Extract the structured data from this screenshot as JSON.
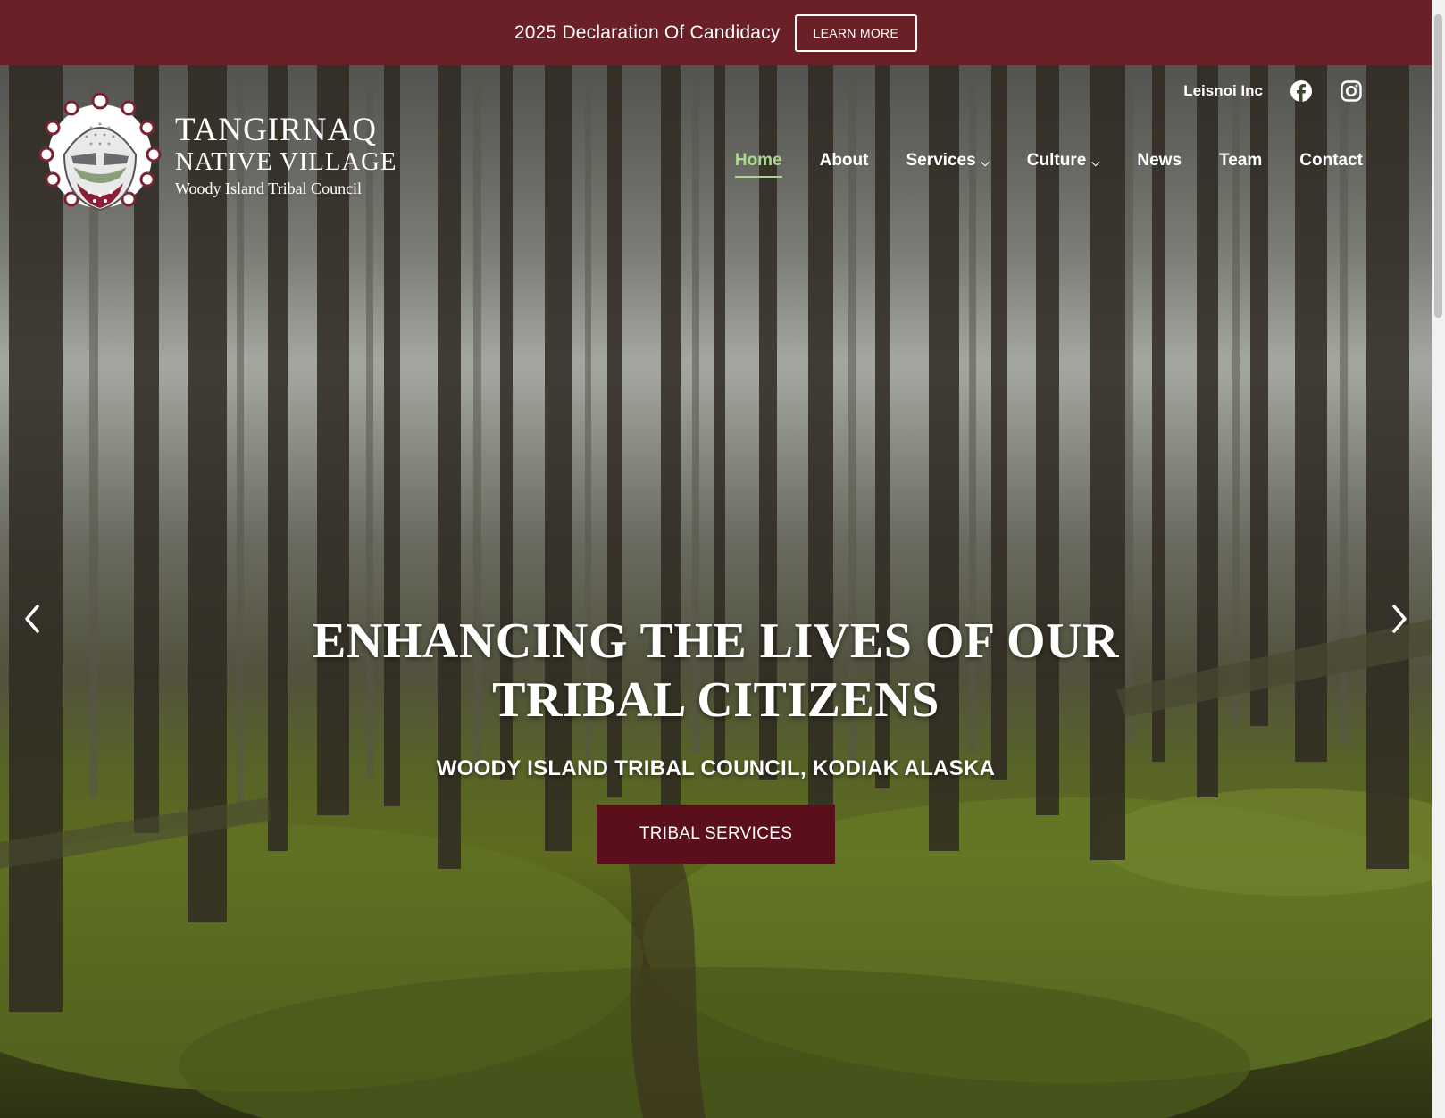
{
  "announcement": {
    "text": "2025 Declaration Of Candidacy",
    "button_label": "LEARN MORE",
    "background_color": "#6b2027"
  },
  "logo": {
    "line1": "TANGIRNAQ",
    "line2": "NATIVE VILLAGE",
    "line3": "Woody Island Tribal Council"
  },
  "utility": {
    "link_label": "Leisnoi Inc",
    "icons": [
      "facebook-icon",
      "instagram-icon"
    ]
  },
  "nav": {
    "items": [
      {
        "label": "Home",
        "active": true,
        "dropdown": false
      },
      {
        "label": "About",
        "active": false,
        "dropdown": false
      },
      {
        "label": "Services",
        "active": false,
        "dropdown": true
      },
      {
        "label": "Culture",
        "active": false,
        "dropdown": true
      },
      {
        "label": "News",
        "active": false,
        "dropdown": false
      },
      {
        "label": "Team",
        "active": false,
        "dropdown": false
      },
      {
        "label": "Contact",
        "active": false,
        "dropdown": false
      }
    ],
    "dropdown_glyph": "⌵",
    "active_color": "#a9d98f"
  },
  "hero": {
    "title_line1": "ENHANCING THE LIVES OF OUR",
    "title_line2": "TRIBAL CITIZENS",
    "subtitle": "WOODY ISLAND TRIBAL COUNCIL, KODIAK ALASKA",
    "button_label": "TRIBAL SERVICES",
    "button_color": "#5b0f1a"
  }
}
